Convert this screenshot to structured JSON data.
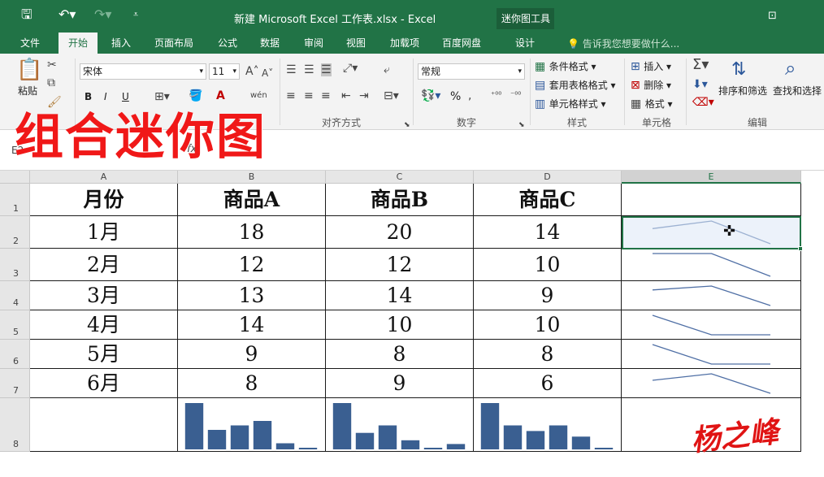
{
  "titlebar": {
    "title": "新建 Microsoft Excel 工作表.xlsx - Excel",
    "contextual_tools": "迷你图工具",
    "save_icon": "save-icon",
    "undo_icon": "undo-icon",
    "redo_icon": "redo-icon",
    "customize_icon": "customize-qat-icon",
    "restore_icon": "ribbon-display-icon"
  },
  "tabs": {
    "file": "文件",
    "home": "开始",
    "insert": "插入",
    "page_layout": "页面布局",
    "formulas": "公式",
    "data": "数据",
    "review": "审阅",
    "view": "视图",
    "addins": "加载项",
    "baidu": "百度网盘",
    "design": "设计",
    "tell_me": "告诉我您想要做什么..."
  },
  "ribbon": {
    "paste": "粘贴",
    "font_name": "宋体",
    "font_size": "11",
    "bold": "B",
    "italic": "I",
    "underline": "U",
    "align_group": "对齐方式",
    "number_format": "常规",
    "number_group": "数字",
    "cond_format": "条件格式",
    "table_format": "套用表格格式",
    "cell_styles": "单元格样式",
    "styles_group": "样式",
    "insert_cells": "插入",
    "delete_cells": "删除",
    "format_cells": "格式",
    "cells_group": "单元格",
    "sort_filter": "排序和筛选",
    "find_select": "查找和选择",
    "editing_group": "编辑",
    "percent": "%"
  },
  "overlay_title": "组合迷你图",
  "formula_bar": {
    "name_box": "E2",
    "fx": "fx"
  },
  "sheet": {
    "columns": [
      "A",
      "B",
      "C",
      "D",
      "E"
    ],
    "row_numbers": [
      "1",
      "2",
      "3",
      "4",
      "5",
      "6",
      "7",
      "8"
    ],
    "headers": [
      "月份",
      "商品A",
      "商品B",
      "商品C"
    ],
    "rows": [
      [
        "1月",
        "18",
        "20",
        "14"
      ],
      [
        "2月",
        "12",
        "12",
        "10"
      ],
      [
        "3月",
        "13",
        "14",
        "9"
      ],
      [
        "4月",
        "14",
        "10",
        "10"
      ],
      [
        "5月",
        "9",
        "8",
        "8"
      ],
      [
        "6月",
        "8",
        "9",
        "6"
      ]
    ],
    "selected_cell": "E2"
  },
  "chart_data": [
    {
      "type": "line",
      "description_source": "row sparklines in column E",
      "series": [
        {
          "values": [
            18,
            20,
            14
          ]
        },
        {
          "values": [
            12,
            12,
            10
          ]
        },
        {
          "values": [
            13,
            14,
            9
          ]
        },
        {
          "values": [
            14,
            10,
            10
          ]
        },
        {
          "values": [
            9,
            8,
            8
          ]
        },
        {
          "values": [
            8,
            9,
            6
          ]
        }
      ],
      "color": "#4f6fa5"
    },
    {
      "type": "bar",
      "description_source": "column sparklines in row 8",
      "series": [
        {
          "values": [
            18,
            12,
            13,
            14,
            9,
            8
          ]
        },
        {
          "values": [
            20,
            12,
            14,
            10,
            8,
            9
          ]
        },
        {
          "values": [
            14,
            10,
            9,
            10,
            8,
            6
          ]
        }
      ],
      "color": "#3a5f91"
    }
  ],
  "signature": "杨之峰"
}
